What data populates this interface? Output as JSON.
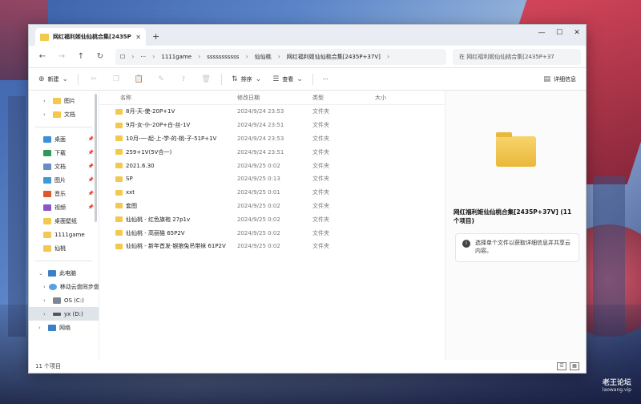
{
  "window": {
    "tab_title": "网红福利姬仙仙桃合集[2435P+3",
    "tab_close": "✕",
    "new_tab": "+",
    "minimize": "—",
    "maximize": "☐",
    "close": "✕"
  },
  "nav": {
    "back": "←",
    "forward": "→",
    "up": "↑",
    "refresh": "↻",
    "monitor": "☐",
    "breadcrumb": [
      "1111game",
      "sssssssssss",
      "仙仙桃",
      "网红福利姬仙仙桃合集[2435P+37V]"
    ],
    "search_placeholder": "在 网红福利姬仙仙桃合集[2435P+37"
  },
  "toolbar": {
    "new_label": "新建",
    "sort_label": "排序",
    "view_label": "查看",
    "more_label": "···",
    "details_label": "详细信息"
  },
  "sidebar": {
    "top_items": [
      {
        "label": "图片"
      },
      {
        "label": "文档"
      }
    ],
    "pinned": [
      {
        "label": "桌面",
        "pin": "📌"
      },
      {
        "label": "下载",
        "pin": "📌"
      },
      {
        "label": "文档",
        "pin": "📌"
      },
      {
        "label": "图片",
        "pin": "📌"
      },
      {
        "label": "音乐",
        "pin": "📌"
      },
      {
        "label": "视频",
        "pin": "📌"
      },
      {
        "label": "桌面壁纸",
        "pin": ""
      },
      {
        "label": "1111game",
        "pin": ""
      },
      {
        "label": "仙桃",
        "pin": ""
      }
    ],
    "computer": {
      "label": "此电脑",
      "items": [
        {
          "label": "移动云盘同步盘"
        },
        {
          "label": "OS (C:)"
        },
        {
          "label": "yx (D:)"
        }
      ]
    },
    "network": "网络"
  },
  "filelist": {
    "headers": {
      "name": "名称",
      "date": "修改日期",
      "type": "类型",
      "size": "大小"
    },
    "rows": [
      {
        "name": "8月-天-使-20P+1V",
        "date": "2024/9/24 23:53",
        "type": "文件夹"
      },
      {
        "name": "9月-女-仆-20P+白-丝-1V",
        "date": "2024/9/24 23:51",
        "type": "文件夹"
      },
      {
        "name": "10月-一-起-上-学-的-桃-子-51P+1V",
        "date": "2024/9/24 23:53",
        "type": "文件夹"
      },
      {
        "name": "259+1V(5V合一)",
        "date": "2024/9/24 23:51",
        "type": "文件夹"
      },
      {
        "name": "2021.6.30",
        "date": "2024/9/25 0:02",
        "type": "文件夹"
      },
      {
        "name": "SP",
        "date": "2024/9/25 0:13",
        "type": "文件夹"
      },
      {
        "name": "xxt",
        "date": "2024/9/25 0:01",
        "type": "文件夹"
      },
      {
        "name": "套图",
        "date": "2024/9/25 0:02",
        "type": "文件夹"
      },
      {
        "name": "仙仙桃 - 红色旗袍 27p1v",
        "date": "2024/9/25 0:02",
        "type": "文件夹"
      },
      {
        "name": "仙仙桃 - 高丽猫 65P2V",
        "date": "2024/9/25 0:02",
        "type": "文件夹"
      },
      {
        "name": "仙仙桃 - 新年首发·银狼兔吊带袜 61P2V",
        "date": "2024/9/25 0:02",
        "type": "文件夹"
      }
    ]
  },
  "details": {
    "folder_name": "网红福利姬仙仙桃合集[2435P+37V] (11 个项目)",
    "info_icon": "i",
    "info_text": "选择单个文件以获取详细信息并共享云内容。"
  },
  "statusbar": {
    "item_count": "11 个项目"
  },
  "wallpaper": {
    "logo": "老王论坛",
    "logo_sub": "laowang.vip"
  },
  "colors": {
    "folder": "#f2c94c",
    "accent": "#0067c0"
  }
}
